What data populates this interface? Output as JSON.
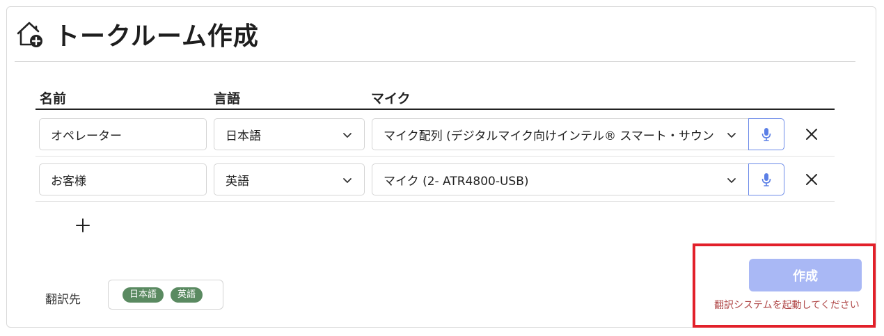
{
  "page": {
    "title": "トークルーム作成"
  },
  "icons": {
    "header": "home-plus-icon",
    "language_select": "chevron-down-icon",
    "mic_test": "microphone-icon",
    "delete": "close-icon",
    "add": "plus-icon"
  },
  "table": {
    "headers": {
      "name": "名前",
      "language": "言語",
      "mic": "マイク"
    },
    "rows": [
      {
        "name": "オペレーター",
        "language": "日本語",
        "mic": "マイク配列 (デジタルマイク向けインテル® スマート・サウンド・テクノロジー)"
      },
      {
        "name": "お客様",
        "language": "英語",
        "mic": "マイク (2- ATR4800-USB)"
      }
    ]
  },
  "translation": {
    "label": "翻訳先",
    "targets": [
      "日本語",
      "英語"
    ]
  },
  "actions": {
    "create_label": "作成",
    "warning": "翻訳システムを起動してください"
  },
  "colors": {
    "accent": "#6b8ae8",
    "create_disabled": "#a9b8f5",
    "chip": "#5a8a61",
    "warning": "#b04848",
    "highlight": "#e2202a"
  }
}
